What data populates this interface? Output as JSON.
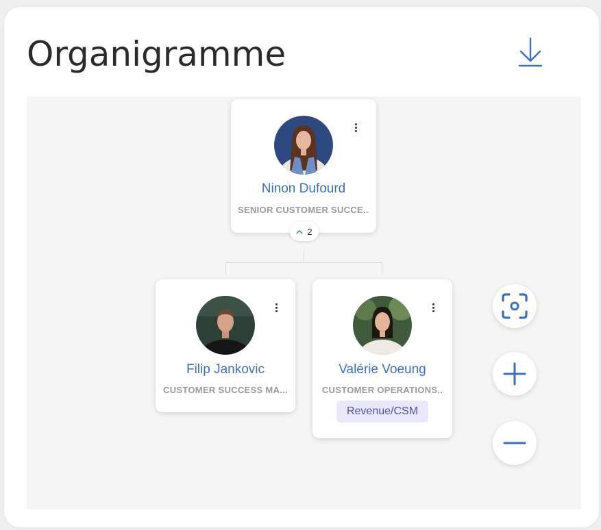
{
  "page": {
    "title": "Organigramme"
  },
  "icons": {
    "download": "download-icon",
    "recenter": "focus-frame-icon",
    "zoom_in": "plus-icon",
    "zoom_out": "minus-icon",
    "more": "kebab-menu-icon",
    "collapse": "chevron-up-icon"
  },
  "colors": {
    "accent": "#3a6fbf",
    "tag_bg": "#e8e8fb",
    "tag_text": "#4f4fb8",
    "role_text": "#999999"
  },
  "org": {
    "root": {
      "name": "Ninon Dufourd",
      "role": "SENIOR CUSTOMER SUCCE...",
      "reports_count": "2"
    },
    "children": [
      {
        "name": "Filip Jankovic",
        "role": "CUSTOMER SUCCESS MA..."
      },
      {
        "name": "Valérie Voeung",
        "role": "CUSTOMER OPERATIONS..",
        "tag": "Revenue/CSM"
      }
    ]
  }
}
